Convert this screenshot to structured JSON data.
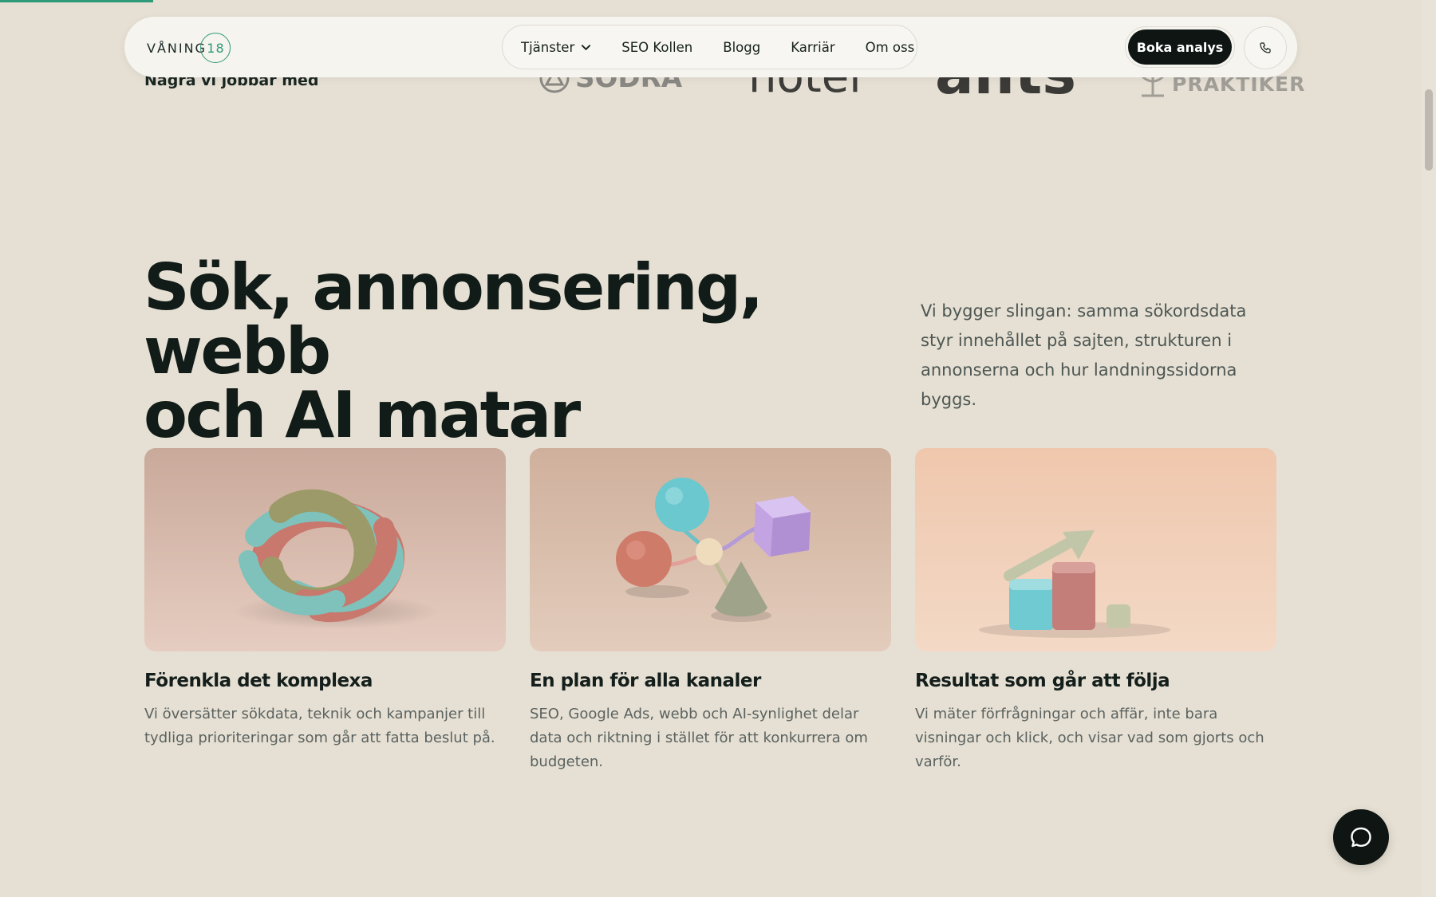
{
  "header": {
    "logo_text": "VÅNING",
    "logo_number": "18",
    "nav": [
      {
        "label": "Tjänster",
        "has_dropdown": true
      },
      {
        "label": "SEO Kollen"
      },
      {
        "label": "Blogg"
      },
      {
        "label": "Karriär"
      },
      {
        "label": "Om oss"
      }
    ],
    "cta_label": "Boka analys",
    "phone_icon": "phone-icon"
  },
  "partners": {
    "label": "Några vi jobbar med",
    "logos": [
      "SÖDRA",
      "hotel",
      "ants",
      "PRAKTIKER"
    ]
  },
  "hero": {
    "title_line1": "Sök, annonsering, webb",
    "title_line2": "och AI matar varandra.",
    "description": "Vi bygger slingan: samma sökordsdata styr innehållet på sajten, strukturen i annonserna och hur landningssidorna byggs."
  },
  "cards": [
    {
      "title": "Förenkla det komplexa",
      "text": "Vi översätter sökdata, teknik och kampanjer till tydliga prioriteringar som går att fatta beslut på."
    },
    {
      "title": "En plan för alla kanaler",
      "text": "SEO, Google Ads, webb och AI-synlighet delar data och riktning i stället för att konkurrera om budgeten."
    },
    {
      "title": "Resultat som går att följa",
      "text": "Vi mäter förfrågningar och affär, inte bara visningar och klick, och visar vad som gjorts och varför."
    }
  ],
  "colors": {
    "background": "#e6e0d4",
    "accent": "#2d9a78",
    "dark": "#0e1512"
  },
  "chat_icon": "chat-bubble-icon"
}
